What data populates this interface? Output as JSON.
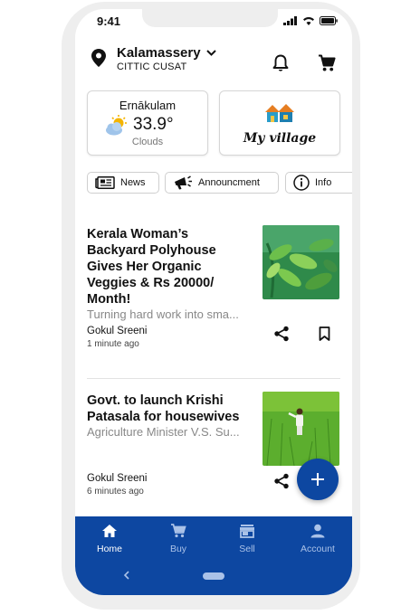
{
  "status_bar": {
    "time": "9:41"
  },
  "header": {
    "city": "Kalamassery",
    "area": "CITTIC CUSAT"
  },
  "weather": {
    "city": "Ernākulam",
    "temperature": "33.9°",
    "condition": "Clouds"
  },
  "village": {
    "label": "My village"
  },
  "chips": [
    {
      "label": "News",
      "icon": "newspaper-icon"
    },
    {
      "label": "Announcment",
      "icon": "megaphone-icon"
    },
    {
      "label": "Info",
      "icon": "info-icon"
    }
  ],
  "articles": [
    {
      "title": "Kerala Woman’s Backyard Polyhouse Gives Her Organic Veggies & Rs 20000/ Month!",
      "title_lines": [
        "Kerala Woman’s",
        "Backyard Polyhouse",
        "Gives Her Organic",
        "Veggies & Rs 20000/",
        "Month!"
      ],
      "subtitle": "Turning hard work into sma...",
      "author": "Gokul Sreeni",
      "time_ago": "1 minute ago"
    },
    {
      "title": "Govt. to launch Krishi Patasala for housewives",
      "title_lines": [
        "Govt. to launch Krishi",
        "Patasala for housewives"
      ],
      "subtitle": "Agriculture Minister V.S. Su...",
      "author": "Gokul Sreeni",
      "time_ago": "6 minutes ago"
    }
  ],
  "bottom_nav": [
    {
      "label": "Home",
      "icon": "home-icon",
      "active": true
    },
    {
      "label": "Buy",
      "icon": "cart-icon",
      "active": false
    },
    {
      "label": "Sell",
      "icon": "store-icon",
      "active": false
    },
    {
      "label": "Account",
      "icon": "account-icon",
      "active": false
    }
  ],
  "colors": {
    "primary": "#0d47a1",
    "nav_inactive": "#aac2e8",
    "text_muted": "#888888"
  }
}
